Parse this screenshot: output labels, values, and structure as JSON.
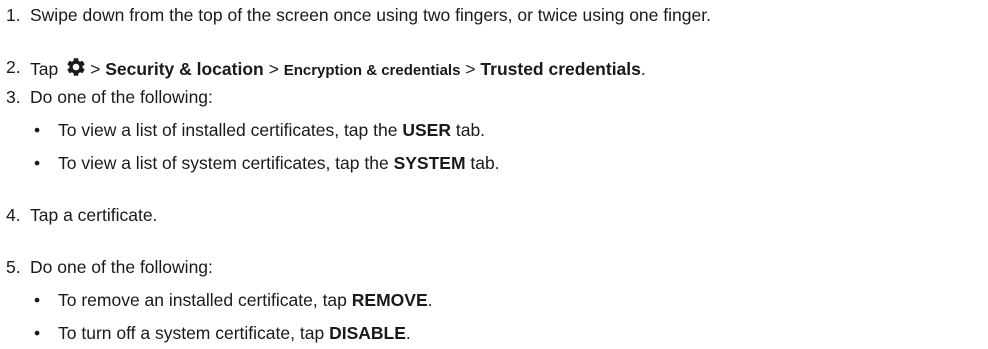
{
  "steps": [
    {
      "num": "1.",
      "text": "Swipe down from the top of the screen once using two fingers, or twice using one finger."
    },
    {
      "num": "2.",
      "tap": "Tap",
      "sep": ">",
      "security": "Security & location",
      "encryption": "Encryption & credentials",
      "trusted": "Trusted credentials",
      "end": "."
    },
    {
      "num": "3.",
      "text": "Do one of the following:",
      "options": [
        {
          "before": "To view a list of installed certificates, tap the",
          "bold": "USER",
          "after": "tab."
        },
        {
          "before": "To view a list of system certificates, tap the",
          "bold": "SYSTEM",
          "after": "tab."
        }
      ]
    },
    {
      "num": "4.",
      "text": "Tap a certificate."
    },
    {
      "num": "5.",
      "text": "Do one of the following:",
      "options": [
        {
          "before": "To remove an installed certificate, tap",
          "bold": "REMOVE",
          "after": "."
        },
        {
          "before": "To turn off a system certificate, tap",
          "bold": "DISABLE",
          "after": "."
        }
      ]
    }
  ],
  "bullet": "•",
  "icons": {
    "settings": "gear-icon"
  }
}
